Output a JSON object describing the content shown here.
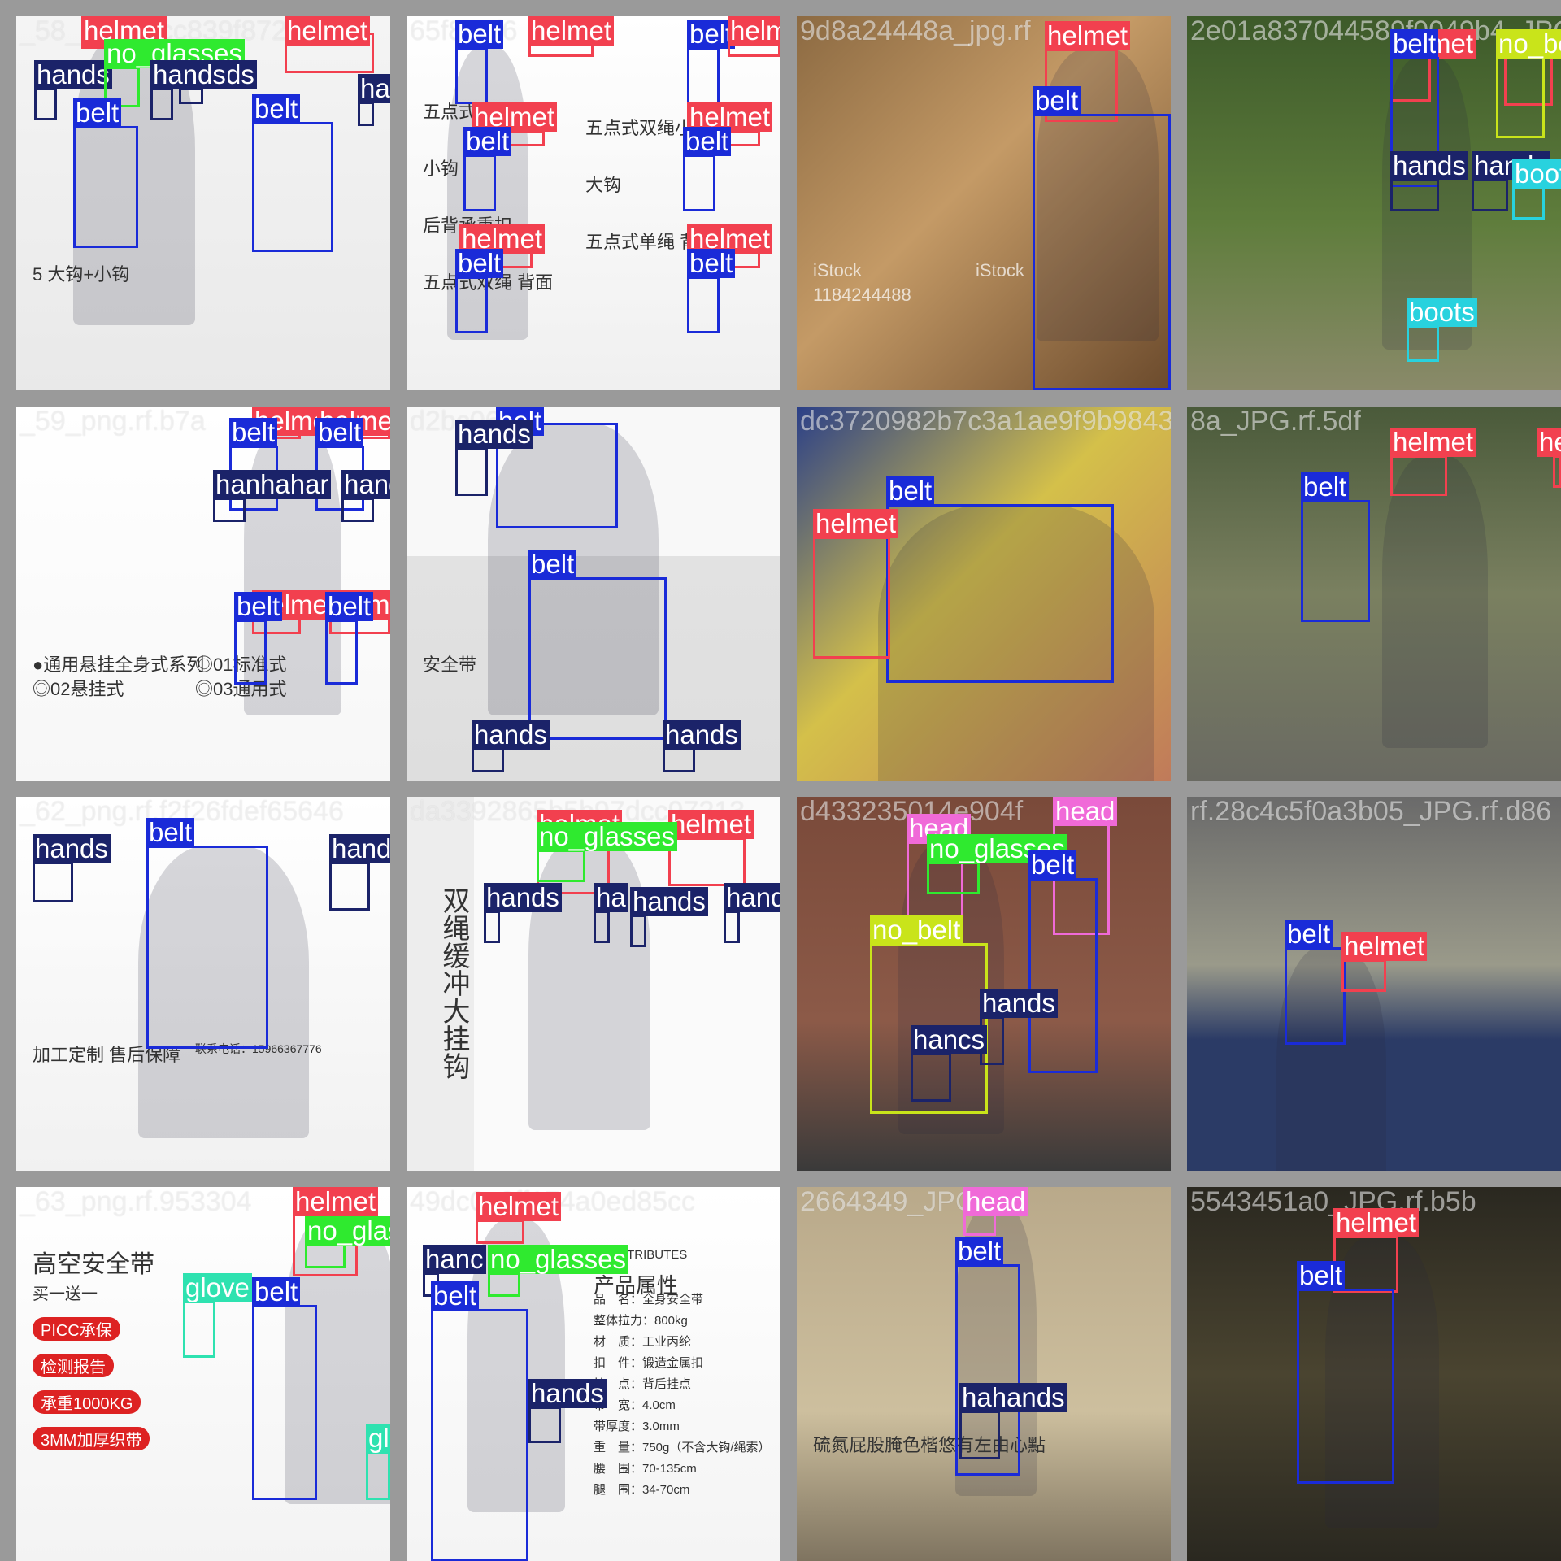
{
  "colors": {
    "helmet": "#f2404f",
    "belt": "#1a2bd8",
    "hands": "#1b2369",
    "no_glasses": "#2fea2f",
    "no_belt": "#c9e41a",
    "boots": "#28d2de",
    "head": "#f06ad8",
    "glove": "#2ee2b0"
  },
  "tiles": [
    {
      "filename": "_58_png.rf.cc839f87248cc",
      "texts": [
        {
          "text": "5 大钩+小钩"
        }
      ],
      "labels": [
        {
          "cls": "helmet",
          "text": "helmet"
        },
        {
          "cls": "helmet",
          "text": "helmet"
        },
        {
          "cls": "hands",
          "text": "hands"
        },
        {
          "cls": "no_glasses",
          "text": "no_glasses"
        },
        {
          "cls": "hands",
          "text": "hands"
        },
        {
          "cls": "hands",
          "text": "hands"
        },
        {
          "cls": "hands",
          "text": "hands"
        },
        {
          "cls": "belt",
          "text": "belt"
        },
        {
          "cls": "belt",
          "text": "belt"
        }
      ]
    },
    {
      "filename": "65f802f6",
      "texts": [
        {
          "text": "五点式单绳小钩"
        },
        {
          "text": "五点式双绳小钩"
        },
        {
          "text": "小钩"
        },
        {
          "text": "大钩"
        },
        {
          "text": "后背承重扣"
        },
        {
          "text": "五点式单绳 背面"
        },
        {
          "text": "五点式双绳 背面"
        }
      ],
      "labels": [
        {
          "cls": "belt",
          "text": "belt"
        },
        {
          "cls": "helmet",
          "text": "helmet"
        },
        {
          "cls": "belt",
          "text": "belt"
        },
        {
          "cls": "helmet",
          "text": "helmet"
        },
        {
          "cls": "helmet",
          "text": "helmet"
        },
        {
          "cls": "helmet",
          "text": "helmet"
        },
        {
          "cls": "belt",
          "text": "belt"
        },
        {
          "cls": "belt",
          "text": "belt"
        },
        {
          "cls": "helmet",
          "text": "helmet"
        },
        {
          "cls": "helmet",
          "text": "helmet"
        },
        {
          "cls": "belt",
          "text": "belt"
        },
        {
          "cls": "belt",
          "text": "belt"
        }
      ]
    },
    {
      "filename": "9d8a24448a_jpg.rf",
      "texts": [
        {
          "text": "iStock"
        },
        {
          "text": "iStock"
        },
        {
          "text": "1184244488"
        }
      ],
      "labels": [
        {
          "cls": "helmet",
          "text": "helmet"
        },
        {
          "cls": "belt",
          "text": "belt"
        }
      ]
    },
    {
      "filename": "2e01a837044589f0049b4_JPG",
      "texts": [],
      "labels": [
        {
          "cls": "helmet",
          "text": "helmet"
        },
        {
          "cls": "helmet",
          "text": "helmet"
        },
        {
          "cls": "belt",
          "text": "belt"
        },
        {
          "cls": "no_belt",
          "text": "no_belt"
        },
        {
          "cls": "hands",
          "text": "hands"
        },
        {
          "cls": "hands",
          "text": "hands"
        },
        {
          "cls": "boots",
          "text": "boots"
        },
        {
          "cls": "boots",
          "text": "boots"
        }
      ]
    },
    {
      "filename": "_59_png.rf.b7a",
      "texts": [
        {
          "text": "●通用悬挂全身式系列"
        },
        {
          "text": "◎01标准式"
        },
        {
          "text": "◎02悬挂式"
        },
        {
          "text": "◎03通用式"
        }
      ],
      "labels": [
        {
          "cls": "helmet",
          "text": "helme"
        },
        {
          "cls": "helmet",
          "text": "helmet"
        },
        {
          "cls": "belt",
          "text": "belt"
        },
        {
          "cls": "belt",
          "text": "belt"
        },
        {
          "cls": "hands",
          "text": "hanhahar"
        },
        {
          "cls": "hands",
          "text": "hands"
        },
        {
          "cls": "helmet",
          "text": "helmet"
        },
        {
          "cls": "helmet",
          "text": "helmet"
        },
        {
          "cls": "belt",
          "text": "belt"
        },
        {
          "cls": "belt",
          "text": "belt"
        }
      ]
    },
    {
      "filename": "d2bc061b",
      "texts": [
        {
          "text": "安全带"
        }
      ],
      "labels": [
        {
          "cls": "belt",
          "text": "belt"
        },
        {
          "cls": "hands",
          "text": "hands"
        },
        {
          "cls": "belt",
          "text": "belt"
        },
        {
          "cls": "hands",
          "text": "hands"
        },
        {
          "cls": "hands",
          "text": "hands"
        }
      ]
    },
    {
      "filename": "dc3720982b7c3a1ae9f9b9843453",
      "texts": [],
      "labels": [
        {
          "cls": "belt",
          "text": "belt"
        },
        {
          "cls": "helmet",
          "text": "helmet"
        }
      ]
    },
    {
      "filename": "8a_JPG.rf.5df",
      "texts": [],
      "labels": [
        {
          "cls": "helmet",
          "text": "helmet"
        },
        {
          "cls": "belt",
          "text": "belt"
        },
        {
          "cls": "helmet",
          "text": "helm"
        }
      ]
    },
    {
      "filename": "_62_png.rf.f2f26fdef65646",
      "texts": [
        {
          "text": "加工定制 售后保障"
        },
        {
          "text": "联系电话：15966367776"
        }
      ],
      "labels": [
        {
          "cls": "belt",
          "text": "belt"
        },
        {
          "cls": "hands",
          "text": "hands"
        },
        {
          "cls": "hands",
          "text": "hands"
        }
      ]
    },
    {
      "filename": "da3392865b5b97dcc97213",
      "texts": [
        {
          "text": "双绳缓冲大挂钩"
        }
      ],
      "labels": [
        {
          "cls": "helmet",
          "text": "helmet"
        },
        {
          "cls": "helmet",
          "text": "helmet"
        },
        {
          "cls": "no_glasses",
          "text": "no_glasses"
        },
        {
          "cls": "hands",
          "text": "hands"
        },
        {
          "cls": "hands",
          "text": "ha"
        },
        {
          "cls": "hands",
          "text": "hands"
        },
        {
          "cls": "hands",
          "text": "hands"
        }
      ]
    },
    {
      "filename": "d433235014e904f",
      "texts": [],
      "labels": [
        {
          "cls": "head",
          "text": "head"
        },
        {
          "cls": "head",
          "text": "head"
        },
        {
          "cls": "no_glasses",
          "text": "no_glasses"
        },
        {
          "cls": "belt",
          "text": "belt"
        },
        {
          "cls": "no_belt",
          "text": "no_belt"
        },
        {
          "cls": "hands",
          "text": "hands"
        },
        {
          "cls": "hands",
          "text": "hancs"
        }
      ]
    },
    {
      "filename": "rf.28c4c5f0a3b05_JPG.rf.d86",
      "texts": [],
      "labels": [
        {
          "cls": "belt",
          "text": "belt"
        },
        {
          "cls": "helmet",
          "text": "helmet"
        }
      ]
    },
    {
      "filename": "_63_png.rf.953304",
      "texts": [
        {
          "text": "高空安全带"
        },
        {
          "text": "买一送一"
        },
        {
          "text": "PICC承保"
        },
        {
          "text": "检测报告"
        },
        {
          "text": "承重1000KG"
        },
        {
          "text": "3MM加厚织带"
        }
      ],
      "labels": [
        {
          "cls": "helmet",
          "text": "helmet"
        },
        {
          "cls": "no_glasses",
          "text": "no_glasses"
        },
        {
          "cls": "glove",
          "text": "glove"
        },
        {
          "cls": "belt",
          "text": "belt"
        },
        {
          "cls": "glove",
          "text": "glove"
        }
      ]
    },
    {
      "filename": "49dc0c6ff174a0ed85cc",
      "texts": [
        {
          "text": "CT ATTRIBUTES"
        },
        {
          "text": "产品属性"
        },
        {
          "text": "品　名：全身安全带"
        },
        {
          "text": "整体拉力：800kg"
        },
        {
          "text": "材　质：工业丙纶"
        },
        {
          "text": "扣　件：锻造金属扣"
        },
        {
          "text": "挂　点：背后挂点"
        },
        {
          "text": "带　宽：4.0cm"
        },
        {
          "text": "带厚度：3.0mm"
        },
        {
          "text": "重　量：750g（不含大钩/绳索）"
        },
        {
          "text": "腰　围：70-135cm"
        },
        {
          "text": "腿　围：34-70cm"
        }
      ],
      "labels": [
        {
          "cls": "helmet",
          "text": "helmet"
        },
        {
          "cls": "hands",
          "text": "hanc"
        },
        {
          "cls": "no_glasses",
          "text": "no_glasses"
        },
        {
          "cls": "belt",
          "text": "belt"
        },
        {
          "cls": "hands",
          "text": "hands"
        }
      ]
    },
    {
      "filename": "2664349_JPG.rf",
      "texts": [
        {
          "text": "硫氮屁股腌色楷悠有左由心點"
        }
      ],
      "labels": [
        {
          "cls": "head",
          "text": "head"
        },
        {
          "cls": "belt",
          "text": "belt"
        },
        {
          "cls": "hands",
          "text": "hahands"
        }
      ]
    },
    {
      "filename": "5543451a0_JPG.rf.b5b",
      "texts": [],
      "labels": [
        {
          "cls": "helmet",
          "text": "helmet"
        },
        {
          "cls": "belt",
          "text": "belt"
        }
      ]
    }
  ]
}
